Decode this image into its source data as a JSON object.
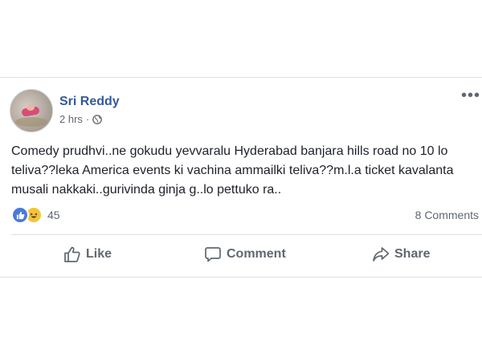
{
  "post": {
    "author": "Sri Reddy",
    "time": "2 hrs",
    "separator": "·",
    "more_label": "•••",
    "body": "Comedy prudhvi..ne gokudu yevvaralu Hyderabad banjara hills road no 10 lo teliva??leka America events ki vachina ammailki teliva??m.l.a ticket kavalanta musali nakkaki..gurivinda ginja g..lo pettuko ra..",
    "reaction_count": "45",
    "comments_count": "8 Comments"
  },
  "actions": {
    "like_label": "Like",
    "comment_label": "Comment",
    "share_label": "Share"
  },
  "colors": {
    "author": "#365899",
    "meta": "#606770",
    "like_reaction": "#4a7bd8",
    "haha_reaction": "#f5c33b"
  },
  "icons": [
    "globe-icon",
    "more-icon",
    "like-reaction-icon",
    "haha-reaction-icon",
    "thumbs-up-icon",
    "comment-icon",
    "share-icon"
  ]
}
